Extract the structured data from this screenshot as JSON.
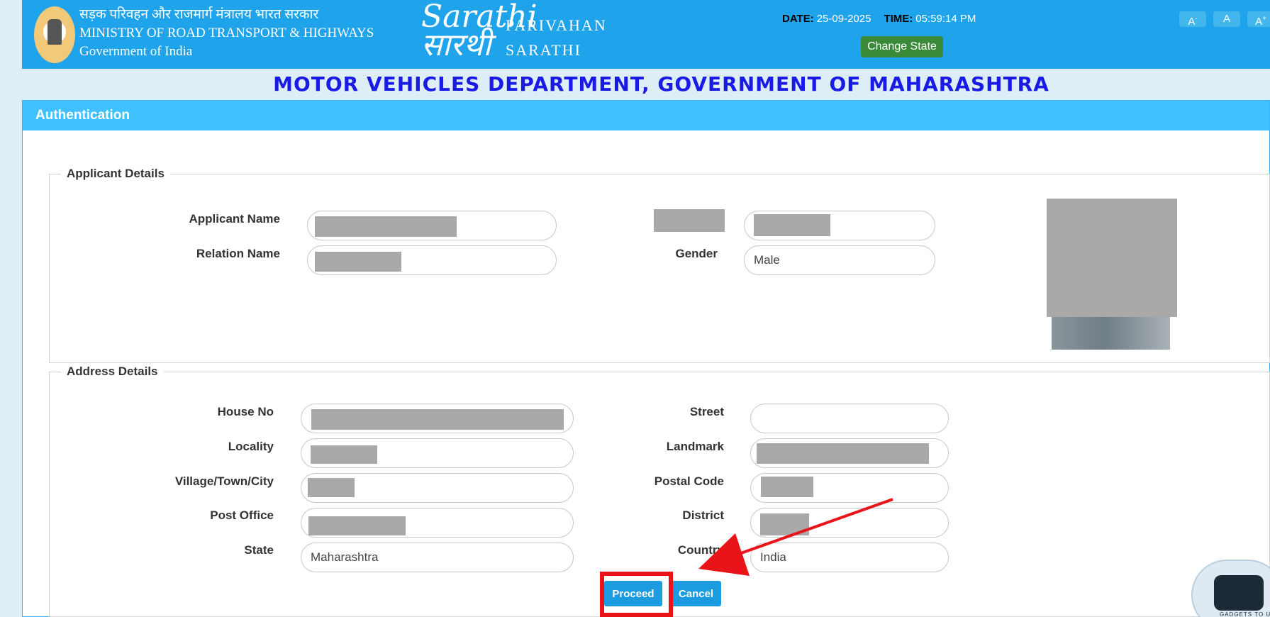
{
  "header": {
    "ministry_hindi": "सड़क परिवहन और राजमार्ग मंत्रालय भारत सरकार",
    "ministry_english": "MINISTRY OF ROAD TRANSPORT & HIGHWAYS",
    "government": "Government of India",
    "logo_script_top": "Sarathi",
    "logo_script_bottom": "सारथी",
    "brand_line1": "PARIVAHAN",
    "brand_line2": "SARATHI",
    "date_label": "DATE:",
    "date_value": "25-09-2025",
    "time_label": "TIME:",
    "time_value": "05:59:14 PM",
    "change_state": "Change State",
    "font_decrease": "A",
    "font_decrease_sup": "-",
    "font_normal": "A",
    "font_increase": "A",
    "font_increase_sup": "+"
  },
  "department_title": "MOTOR VEHICLES DEPARTMENT, GOVERNMENT OF MAHARASHTRA",
  "panel": {
    "title": "Authentication"
  },
  "applicant": {
    "legend": "Applicant Details",
    "applicant_name_label": "Applicant Name",
    "relation_name_label": "Relation Name",
    "gender_label": "Gender",
    "gender_value": "Male"
  },
  "address": {
    "legend": "Address Details",
    "house_no_label": "House No",
    "locality_label": "Locality",
    "village_label": "Village/Town/City",
    "post_office_label": "Post Office",
    "state_label": "State",
    "state_value": "Maharashtra",
    "street_label": "Street",
    "landmark_label": "Landmark",
    "postal_code_label": "Postal Code",
    "district_label": "District",
    "country_label": "Country",
    "country_value": "India"
  },
  "actions": {
    "proceed": "Proceed",
    "cancel": "Cancel"
  },
  "watermark": {
    "caption": "GADGETS TO USE"
  },
  "colors": {
    "header_bg": "#1fa3ea",
    "panel_head": "#40c0ff",
    "title_blue": "#1a1ae6",
    "button_blue": "#1b9be0",
    "annotation_red": "#e8141a"
  }
}
